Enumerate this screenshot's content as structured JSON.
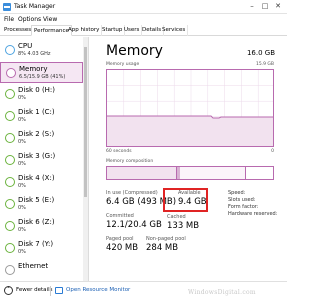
{
  "window": {
    "title": "Task Manager"
  },
  "menu": [
    "File",
    "Options",
    "View"
  ],
  "tabs": [
    "Processes",
    "Performance",
    "App history",
    "Startup",
    "Users",
    "Details",
    "Services"
  ],
  "active_tab": "Performance",
  "sidebar": {
    "items": [
      {
        "name": "CPU",
        "sub": "8% 4.03 GHz"
      },
      {
        "name": "Memory",
        "sub": "6.5/15.9 GB (41%)"
      },
      {
        "name": "Disk 0 (H:)",
        "sub": "0%"
      },
      {
        "name": "Disk 1 (C:)",
        "sub": "0%"
      },
      {
        "name": "Disk 2 (S:)",
        "sub": "0%"
      },
      {
        "name": "Disk 3 (G:)",
        "sub": "0%"
      },
      {
        "name": "Disk 4 (X:)",
        "sub": "0%"
      },
      {
        "name": "Disk 5 (E:)",
        "sub": "0%"
      },
      {
        "name": "Disk 6 (Z:)",
        "sub": "0%"
      },
      {
        "name": "Disk 7 (Y:)",
        "sub": "0%"
      },
      {
        "name": "Ethernet",
        "sub": ""
      }
    ]
  },
  "main": {
    "title": "Memory",
    "total": "16.0 GB",
    "usage_label": "Memory usage",
    "usage_max": "15.9 GB",
    "time_label": "60 seconds",
    "zero_label": "0",
    "composition_label": "Memory composition",
    "stats": {
      "in_use_label": "In use (Compressed)",
      "in_use_value": "6.4 GB (493 MB)",
      "available_label": "Available",
      "available_value": "9.4 GB",
      "committed_label": "Committed",
      "committed_value": "12.1/20.4 GB",
      "cached_label": "Cached",
      "cached_value": "133 MB",
      "paged_label": "Paged pool",
      "paged_value": "420 MB",
      "nonpaged_label": "Non-paged pool",
      "nonpaged_value": "284 MB"
    },
    "specs": [
      {
        "label": "Speed:",
        "value": ""
      },
      {
        "label": "Slots used:",
        "value": ""
      },
      {
        "label": "Form factor:",
        "value": ""
      },
      {
        "label": "Hardware reserved:",
        "value": ""
      }
    ]
  },
  "footer": {
    "fewer_details": "Fewer details",
    "open_monitor": "Open Resource Monitor"
  },
  "watermark": "WindowsDigital.com",
  "colors": {
    "memory_accent": "#b86aaf",
    "cpu_accent": "#4ea3e0",
    "disk_accent": "#6bb33d",
    "link": "#1a5fb4",
    "highlight": "#e02424"
  }
}
